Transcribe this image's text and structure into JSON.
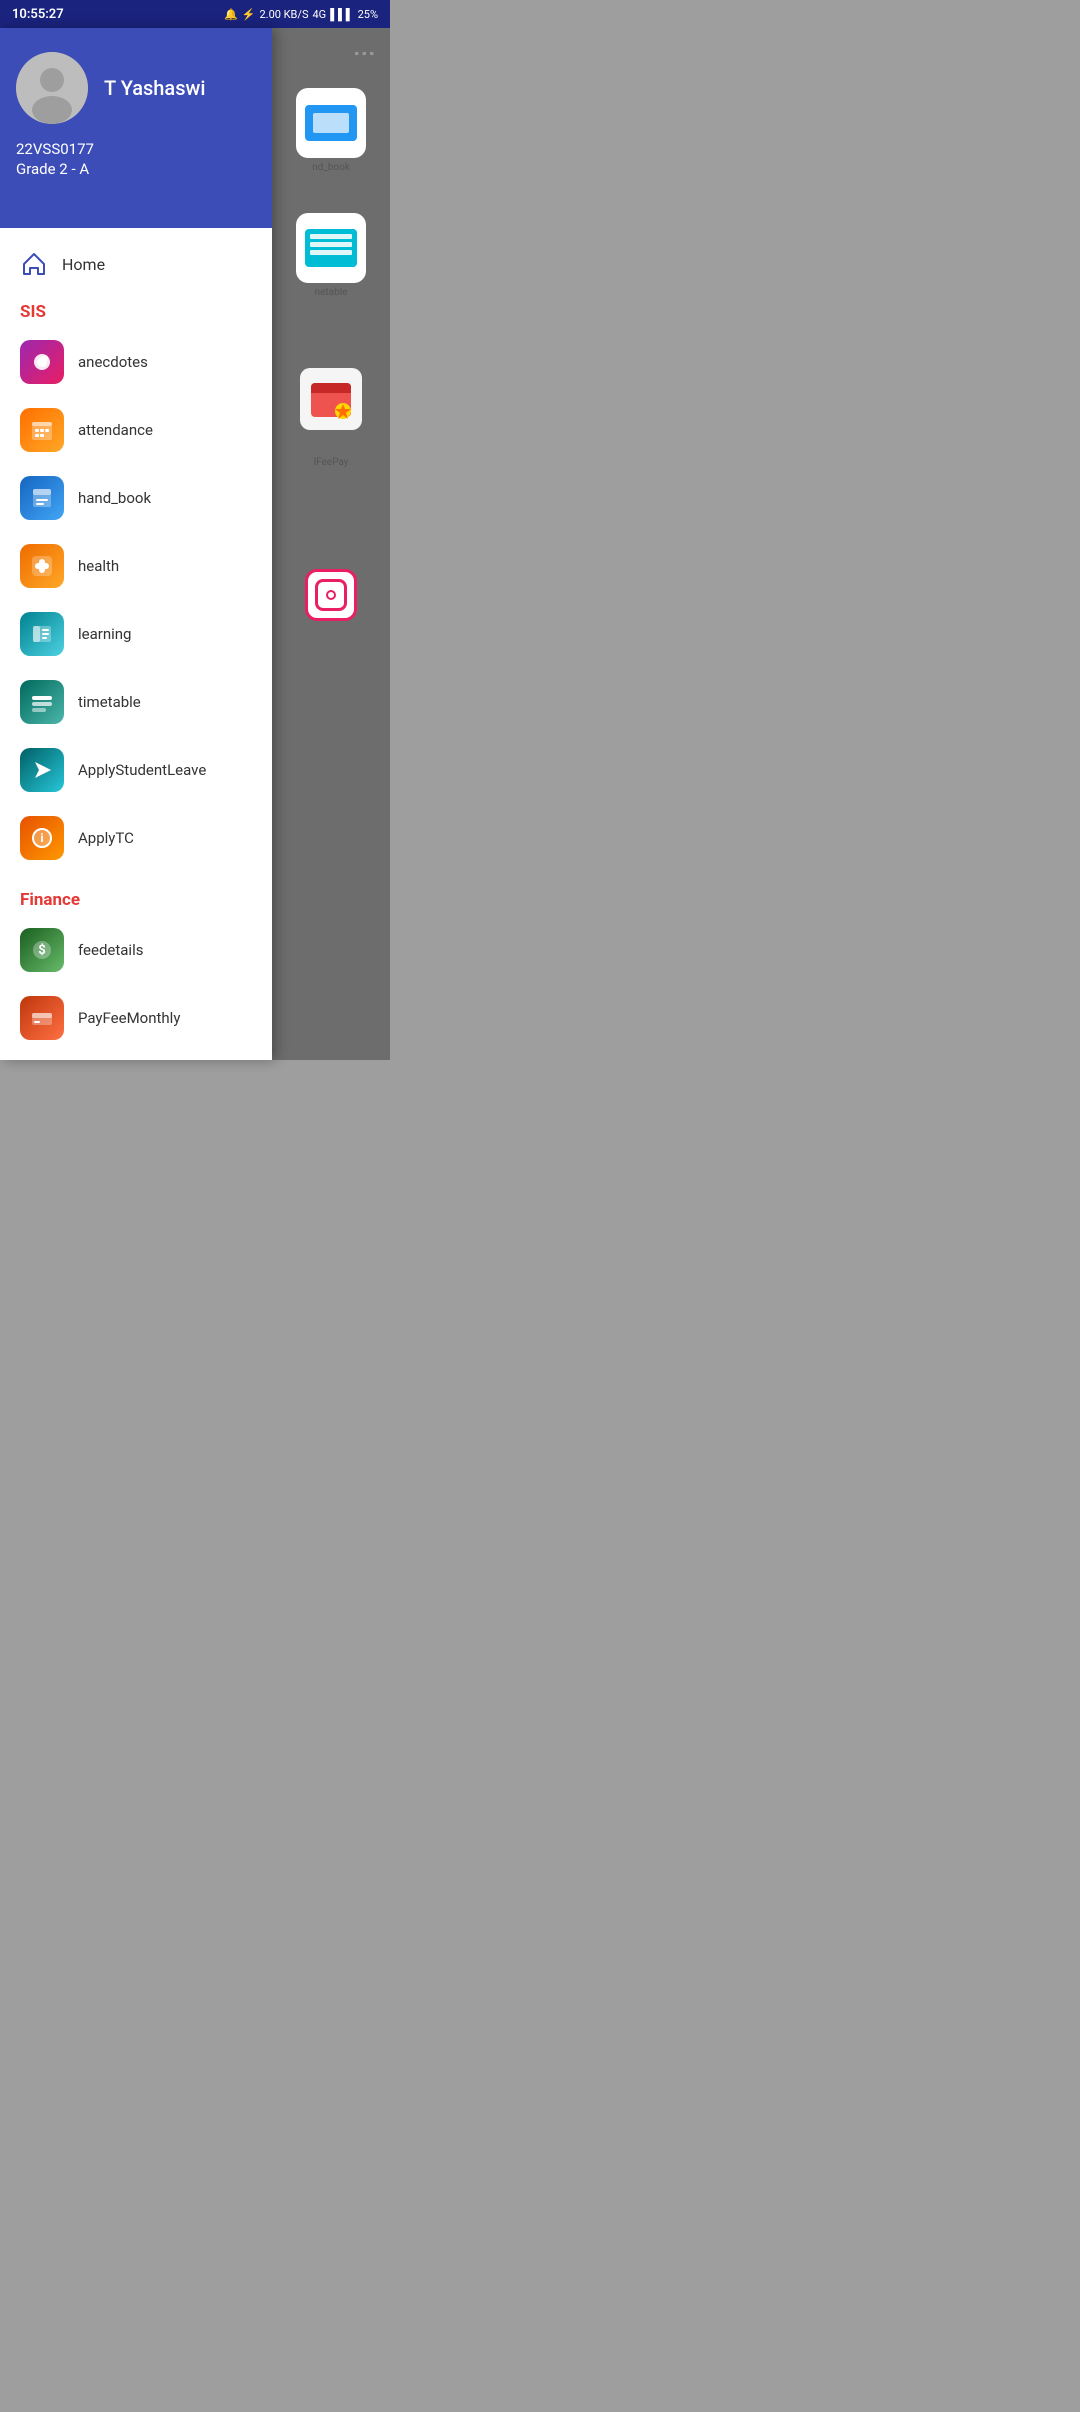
{
  "statusBar": {
    "time": "10:55:27",
    "battery": "25%",
    "signal": "4G",
    "data": "2.00 KB/S"
  },
  "profile": {
    "name": "T Yashaswi",
    "id": "22VSS0177",
    "grade": "Grade 2 - A"
  },
  "nav": {
    "home_label": "Home",
    "sis_label": "SIS",
    "finance_label": "Finance",
    "items": [
      {
        "id": "anecdotes",
        "label": "anecdotes",
        "icon": "🔵",
        "icon_class": "icon-anecdotes"
      },
      {
        "id": "attendance",
        "label": "attendance",
        "icon": "📅",
        "icon_class": "icon-attendance"
      },
      {
        "id": "hand_book",
        "label": "hand_book",
        "icon": "📖",
        "icon_class": "icon-handbook"
      },
      {
        "id": "health",
        "label": "health",
        "icon": "➕",
        "icon_class": "icon-health"
      },
      {
        "id": "learning",
        "label": "learning",
        "icon": "📚",
        "icon_class": "icon-learning"
      },
      {
        "id": "timetable",
        "label": "timetable",
        "icon": "≡",
        "icon_class": "icon-timetable"
      },
      {
        "id": "apply-student-leave",
        "label": "ApplyStudentLeave",
        "icon": "📢",
        "icon_class": "icon-applyleave"
      },
      {
        "id": "apply-tc",
        "label": "ApplyTC",
        "icon": "ℹ",
        "icon_class": "icon-applytc"
      }
    ],
    "finance_items": [
      {
        "id": "feedetails",
        "label": "feedetails",
        "icon": "💰",
        "icon_class": "icon-feedetails"
      },
      {
        "id": "payfeemonthly",
        "label": "PayFeeMonthly",
        "icon": "💳",
        "icon_class": "icon-payfeemonthly"
      }
    ]
  },
  "right_panel": {
    "items": [
      {
        "label": "nd_book"
      },
      {
        "label": "netable"
      },
      {
        "label": "IFeePay"
      }
    ]
  },
  "dots_menu": "⋮"
}
